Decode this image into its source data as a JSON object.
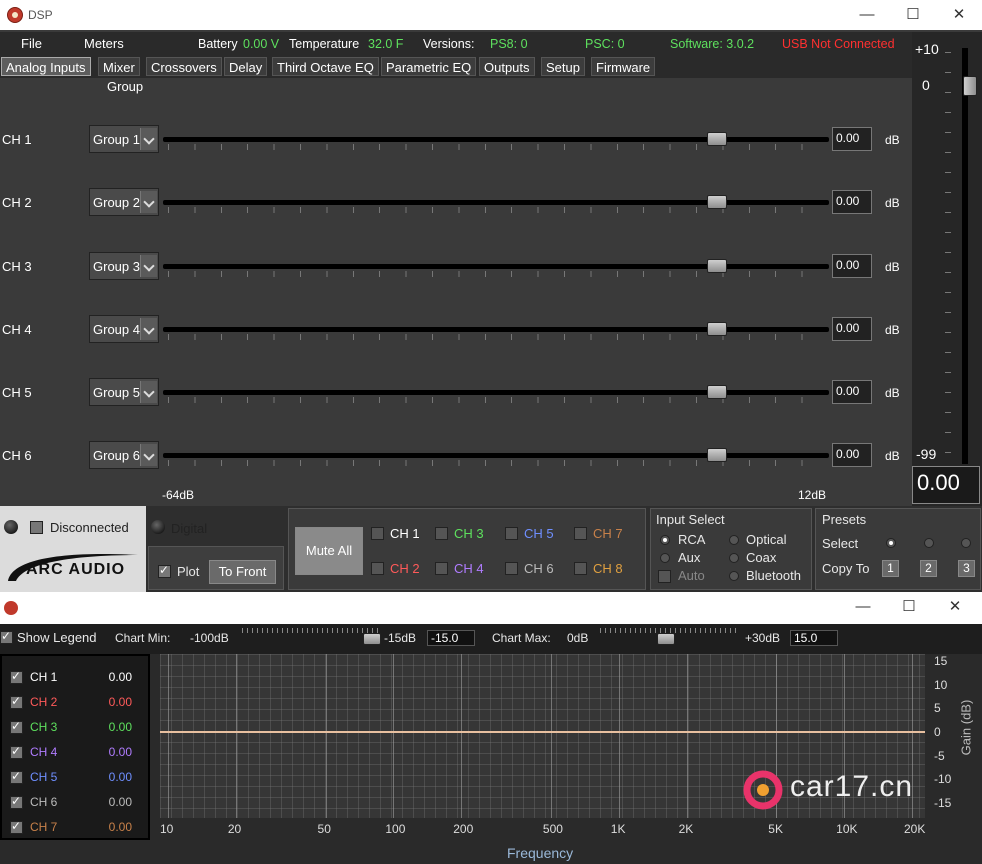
{
  "window": {
    "title": "DSP",
    "min": "—",
    "max": "☐",
    "close": "✕"
  },
  "menu": {
    "file": "File",
    "meters": "Meters"
  },
  "status": {
    "battery_label": "Battery",
    "battery_value": "0.00 V",
    "temp_label": "Temperature",
    "temp_value": "32.0 F",
    "versions_label": "Versions:",
    "ps8": "PS8: 0",
    "psc": "PSC: 0",
    "software": "Software: 3.0.2",
    "usb": "USB Not Connected"
  },
  "colors": {
    "green": "#5ee05e",
    "red": "#ff3030",
    "accent_line": "#e8c0a0"
  },
  "tabs": [
    "Analog Inputs",
    "Mixer",
    "Crossovers",
    "Delay",
    "Third Octave EQ",
    "Parametric EQ",
    "Outputs",
    "Setup",
    "Firmware"
  ],
  "group_header": "Group",
  "channels": [
    {
      "name": "CH 1",
      "group": "Group 1",
      "value": "0.00",
      "unit": "dB",
      "level": 0.842
    },
    {
      "name": "CH 2",
      "group": "Group 2",
      "value": "0.00",
      "unit": "dB",
      "level": 0.842
    },
    {
      "name": "CH 3",
      "group": "Group 3",
      "value": "0.00",
      "unit": "dB",
      "level": 0.842
    },
    {
      "name": "CH 4",
      "group": "Group 4",
      "value": "0.00",
      "unit": "dB",
      "level": 0.842
    },
    {
      "name": "CH 5",
      "group": "Group 5",
      "value": "0.00",
      "unit": "dB",
      "level": 0.842
    },
    {
      "name": "CH 6",
      "group": "Group 6",
      "value": "0.00",
      "unit": "dB",
      "level": 0.842
    }
  ],
  "scale": {
    "min": "-64dB",
    "max": "12dB"
  },
  "master": {
    "top": "+10",
    "zero": "0",
    "bottom": "-99",
    "value": "0.00"
  },
  "connection": {
    "disconnected": "Disconnected",
    "digital": "Digital"
  },
  "logo": {
    "text": "ARC AUDIO"
  },
  "plot_controls": {
    "plot": "Plot",
    "to_front": "To Front"
  },
  "mute": {
    "label": "Mute All",
    "channels": [
      {
        "name": "CH 1",
        "color": "#ffffff"
      },
      {
        "name": "CH 3",
        "color": "#5ee05e"
      },
      {
        "name": "CH 5",
        "color": "#6f8fff"
      },
      {
        "name": "CH 7",
        "color": "#c8814a"
      },
      {
        "name": "CH 2",
        "color": "#ff5a5a"
      },
      {
        "name": "CH 4",
        "color": "#b07cff"
      },
      {
        "name": "CH 6",
        "color": "#bbbbbb"
      },
      {
        "name": "CH 8",
        "color": "#e0a040"
      }
    ]
  },
  "input_select": {
    "title": "Input Select",
    "rca": "RCA",
    "aux": "Aux",
    "auto": "Auto",
    "optical": "Optical",
    "coax": "Coax",
    "bluetooth": "Bluetooth"
  },
  "presets": {
    "title": "Presets",
    "select": "Select",
    "copy_to": "Copy To",
    "nums": [
      "1",
      "2",
      "3"
    ]
  },
  "chart_window": {
    "show_legend": "Show Legend",
    "chart_min_label": "Chart Min:",
    "chart_min_left": "-100dB",
    "chart_min_right": "-15dB",
    "chart_min_value": "-15.0",
    "chart_max_label": "Chart Max:",
    "chart_max_left": "0dB",
    "chart_max_right": "+30dB",
    "chart_max_value": "15.0"
  },
  "legend": [
    {
      "name": "CH 1",
      "value": "0.00",
      "color": "#ffffff"
    },
    {
      "name": "CH 2",
      "value": "0.00",
      "color": "#ff5a5a"
    },
    {
      "name": "CH 3",
      "value": "0.00",
      "color": "#5ee05e"
    },
    {
      "name": "CH 4",
      "value": "0.00",
      "color": "#b07cff"
    },
    {
      "name": "CH 5",
      "value": "0.00",
      "color": "#6f8fff"
    },
    {
      "name": "CH 6",
      "value": "0.00",
      "color": "#bbbbbb"
    },
    {
      "name": "CH 7",
      "value": "0.00",
      "color": "#c8814a"
    }
  ],
  "chart_data": {
    "type": "line",
    "xlabel": "Frequency",
    "ylabel": "Gain (dB)",
    "x_ticks": [
      "10",
      "20",
      "50",
      "100",
      "200",
      "500",
      "1K",
      "2K",
      "5K",
      "10K",
      "20K"
    ],
    "y_ticks": [
      "15",
      "10",
      "5",
      "0",
      "-5",
      "-10",
      "-15"
    ],
    "ylim": [
      -15,
      15
    ],
    "series": [
      {
        "values": [
          0,
          0
        ]
      }
    ]
  },
  "watermark": "car17.cn"
}
